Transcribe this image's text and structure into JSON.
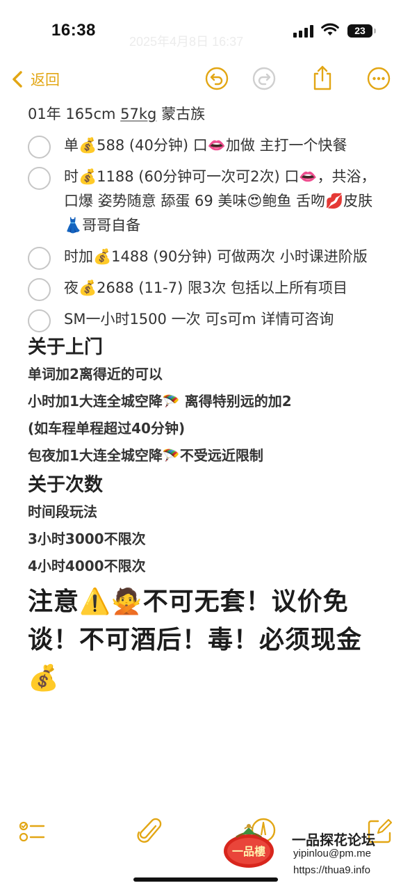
{
  "status_bar": {
    "time": "16:38",
    "ghost_date": "2025年4月8日 16:37",
    "battery": "23"
  },
  "nav": {
    "back_label": "返回",
    "icons": [
      "undo-icon",
      "redo-icon",
      "share-icon",
      "more-icon"
    ],
    "accent_color": "#E2A614"
  },
  "note": {
    "meta": {
      "prefix": "01年 165cm ",
      "weight": "57kg",
      "suffix": " 蒙古族"
    },
    "checklist": [
      {
        "text": "单💰588 (40分钟) 口👄加做 主打一个快餐"
      },
      {
        "text": "时💰1188 (60分钟可一次可2次) 口👄，共浴， 口爆 姿势随意 舔蛋 69 美味😍鲍鱼   舌吻💋皮肤👗哥哥自备"
      },
      {
        "text": "时加💰1488 (90分钟) 可做两次 小时课进阶版"
      },
      {
        "text": "夜💰2688 (11-7) 限3次 包括以上所有项目"
      },
      {
        "text": "SM一小时1500 一次 可s可m 详情可咨询"
      }
    ],
    "heading_visit": "关于上门",
    "visit_lines": [
      "单词加2离得近的可以",
      "小时加1大连全城空降🪂 离得特别远的加2",
      "(如车程单程超过40分钟)",
      "包夜加1大连全城空降🪂不受远近限制"
    ],
    "heading_count": "关于次数",
    "count_lines": [
      "时间段玩法",
      "3小时3000不限次",
      "4小时4000不限次"
    ],
    "warning": "注意⚠️🙅不可无套！议价免谈！不可酒后！毒！必须现金💰"
  },
  "toolbar": {
    "icons": [
      "checklist-icon",
      "attachment-icon",
      "markup-icon",
      "compose-icon"
    ]
  },
  "watermark": {
    "logo_text": "一品樓",
    "title": "一品探花论坛",
    "email": "yipinlou@pm.me",
    "url": "https://thua9.info"
  }
}
